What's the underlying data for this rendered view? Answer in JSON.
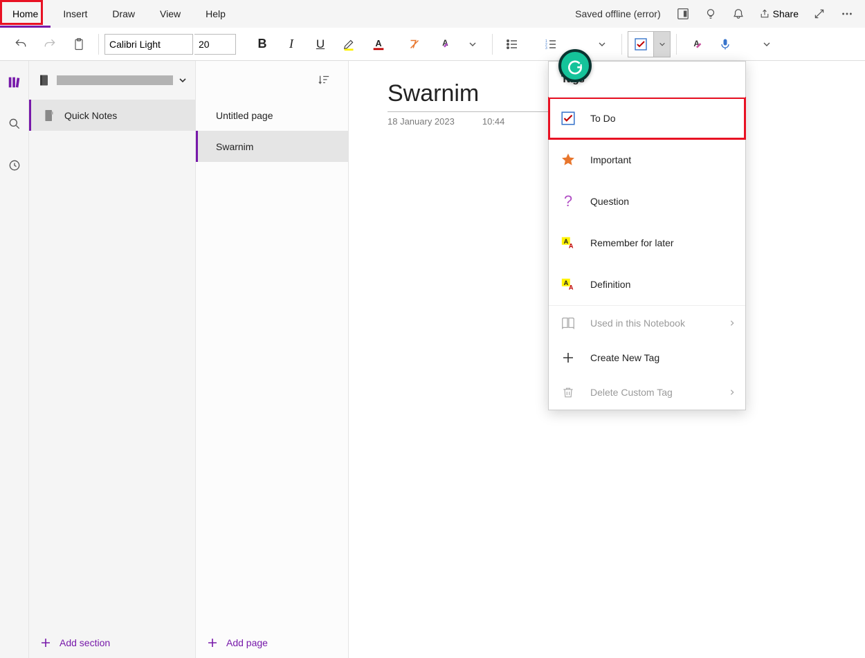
{
  "menu": {
    "items": [
      "Home",
      "Insert",
      "Draw",
      "View",
      "Help"
    ],
    "active_index": 0
  },
  "header": {
    "saved_status": "Saved offline (error)",
    "share_label": "Share"
  },
  "ribbon": {
    "font_name": "Calibri Light",
    "font_size": "20"
  },
  "sections": {
    "items": [
      "Quick Notes"
    ],
    "selected_index": 0,
    "add_label": "Add section"
  },
  "pages": {
    "items": [
      "Untitled page",
      "Swarnim"
    ],
    "selected_index": 1,
    "add_label": "Add page"
  },
  "page": {
    "title": "Swarnim",
    "date": "18 January 2023",
    "time": "10:44"
  },
  "tags_dropdown": {
    "header": "Tags",
    "items": [
      {
        "label": "To Do",
        "icon": "checkbox",
        "highlight": true
      },
      {
        "label": "Important",
        "icon": "star"
      },
      {
        "label": "Question",
        "icon": "question"
      },
      {
        "label": "Remember for later",
        "icon": "aa"
      },
      {
        "label": "Definition",
        "icon": "aa"
      }
    ],
    "footer": [
      {
        "label": "Used in this Notebook",
        "icon": "book",
        "disabled": true,
        "chev": true
      },
      {
        "label": "Create New Tag",
        "icon": "plus"
      },
      {
        "label": "Delete Custom Tag",
        "icon": "trash",
        "disabled": true,
        "chev": true
      }
    ]
  }
}
